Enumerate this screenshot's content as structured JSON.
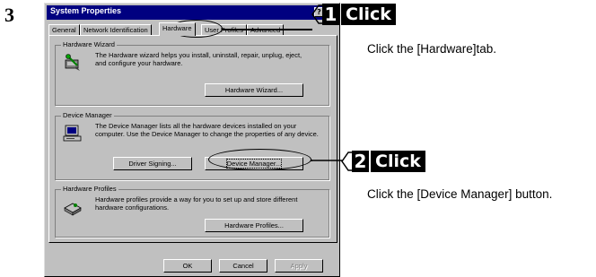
{
  "step_number": "3",
  "dialog": {
    "title": "System Properties",
    "help_button": "?",
    "close_button": "×",
    "tabs": [
      {
        "label": "General"
      },
      {
        "label": "Network Identification"
      },
      {
        "label": "Hardware"
      },
      {
        "label": "User Profiles"
      },
      {
        "label": "Advanced"
      }
    ],
    "hardware_wizard": {
      "legend": "Hardware Wizard",
      "text": "The Hardware wizard helps you install, uninstall, repair, unplug, eject, and configure your hardware.",
      "button": "Hardware Wizard...",
      "icon": "hardware-wizard-icon"
    },
    "device_manager": {
      "legend": "Device Manager",
      "text": "The Device Manager lists all the hardware devices installed on your computer. Use the Device Manager to change the properties of any device.",
      "driver_signing_button": "Driver Signing...",
      "device_manager_button": "Device Manager...",
      "icon": "computer-icon"
    },
    "hardware_profiles": {
      "legend": "Hardware Profiles",
      "text": "Hardware profiles provide a way for you to set up and store different hardware configurations.",
      "button": "Hardware Profiles...",
      "icon": "hardware-profiles-icon"
    },
    "ok_button": "OK",
    "cancel_button": "Cancel",
    "apply_button": "Apply"
  },
  "callouts": [
    {
      "number": "1",
      "word": "Click",
      "instruction": "Click the [Hardware]tab."
    },
    {
      "number": "2",
      "word": "Click",
      "instruction": "Click the [Device Manager] button."
    }
  ],
  "colors": {
    "titlebar": "#000080",
    "dialog_face": "#c0c0c0",
    "badge": "#000000"
  }
}
